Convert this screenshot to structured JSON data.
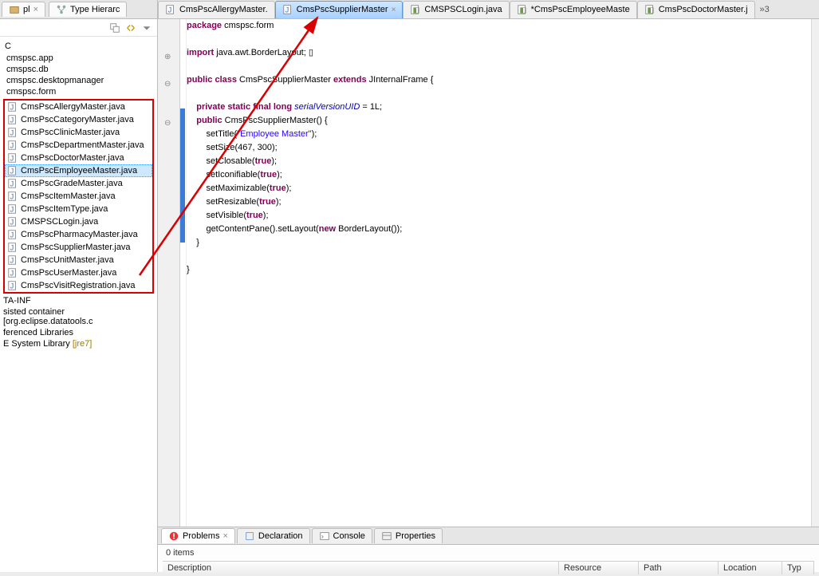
{
  "sidebar": {
    "tabs": [
      {
        "label": "pl"
      },
      {
        "label": "Type Hierarc"
      }
    ],
    "root": "C",
    "packages": [
      "cmspsc.app",
      "cmspsc.db",
      "cmspsc.desktopmanager",
      "cmspsc.form"
    ],
    "files": [
      "CmsPscAllergyMaster.java",
      "CmsPscCategoryMaster.java",
      "CmsPscClinicMaster.java",
      "CmsPscDepartmentMaster.java",
      "CmsPscDoctorMaster.java",
      "CmsPscEmployeeMaster.java",
      "CmsPscGradeMaster.java",
      "CmsPscItemMaster.java",
      "CmsPscItemType.java",
      "CMSPSCLogin.java",
      "CmsPscPharmacyMaster.java",
      "CmsPscSupplierMaster.java",
      "CmsPscUnitMaster.java",
      "CmsPscUserMaster.java",
      "CmsPscVisitRegistration.java"
    ],
    "selected_file_index": 5,
    "others": [
      "TA-INF",
      "sisted container [org.eclipse.datatools.c",
      "ferenced Libraries"
    ],
    "jre": {
      "prefix": "E System Library ",
      "suffix": "[jre7]"
    }
  },
  "editor": {
    "tabs": [
      {
        "label": "CmsPscAllergyMaster.",
        "type": "java"
      },
      {
        "label": "CmsPscSupplierMaster",
        "type": "java",
        "active": true
      },
      {
        "label": "CMSPSCLogin.java",
        "type": "form"
      },
      {
        "label": "*CmsPscEmployeeMaste",
        "type": "form"
      },
      {
        "label": "CmsPscDoctorMaster.j",
        "type": "form"
      }
    ],
    "more": "»3",
    "code": {
      "tokens": [
        {
          "t": "kw",
          "v": "package"
        },
        {
          "t": "p",
          "v": " cmspsc.form"
        },
        {
          "t": "nl"
        },
        {
          "t": "nl"
        },
        {
          "t": "kw",
          "v": "import"
        },
        {
          "t": "p",
          "v": " java.awt.BorderLayout; "
        },
        {
          "t": "sq",
          "v": "▯"
        },
        {
          "t": "nl"
        },
        {
          "t": "nl"
        },
        {
          "t": "kw",
          "v": "public"
        },
        {
          "t": "p",
          "v": " "
        },
        {
          "t": "kw",
          "v": "class"
        },
        {
          "t": "p",
          "v": " CmsPscSupplierMaster "
        },
        {
          "t": "kw",
          "v": "extends"
        },
        {
          "t": "p",
          "v": " JInternalFrame {"
        },
        {
          "t": "nl"
        },
        {
          "t": "nl"
        },
        {
          "t": "i",
          "v": "    "
        },
        {
          "t": "kw",
          "v": "private"
        },
        {
          "t": "p",
          "v": " "
        },
        {
          "t": "kw",
          "v": "static"
        },
        {
          "t": "p",
          "v": " "
        },
        {
          "t": "kw",
          "v": "final"
        },
        {
          "t": "p",
          "v": " "
        },
        {
          "t": "kw",
          "v": "long"
        },
        {
          "t": "p",
          "v": " "
        },
        {
          "t": "field",
          "v": "serialVersionUID"
        },
        {
          "t": "p",
          "v": " = 1L;"
        },
        {
          "t": "nl"
        },
        {
          "t": "i",
          "v": "    "
        },
        {
          "t": "kw",
          "v": "public"
        },
        {
          "t": "p",
          "v": " CmsPscSupplierMaster() {"
        },
        {
          "t": "nl"
        },
        {
          "t": "i",
          "v": "        "
        },
        {
          "t": "p",
          "v": "setTitle("
        },
        {
          "t": "str",
          "v": "\"Employee Master\""
        },
        {
          "t": "p",
          "v": ");"
        },
        {
          "t": "nl"
        },
        {
          "t": "i",
          "v": "        "
        },
        {
          "t": "p",
          "v": "setSize(467, 300);"
        },
        {
          "t": "nl"
        },
        {
          "t": "i",
          "v": "        "
        },
        {
          "t": "p",
          "v": "setClosable("
        },
        {
          "t": "kw",
          "v": "true"
        },
        {
          "t": "p",
          "v": ");"
        },
        {
          "t": "nl"
        },
        {
          "t": "i",
          "v": "        "
        },
        {
          "t": "p",
          "v": "setIconifiable("
        },
        {
          "t": "kw",
          "v": "true"
        },
        {
          "t": "p",
          "v": ");"
        },
        {
          "t": "nl"
        },
        {
          "t": "i",
          "v": "        "
        },
        {
          "t": "p",
          "v": "setMaximizable("
        },
        {
          "t": "kw",
          "v": "true"
        },
        {
          "t": "p",
          "v": ");"
        },
        {
          "t": "nl"
        },
        {
          "t": "i",
          "v": "        "
        },
        {
          "t": "p",
          "v": "setResizable("
        },
        {
          "t": "kw",
          "v": "true"
        },
        {
          "t": "p",
          "v": ");"
        },
        {
          "t": "nl"
        },
        {
          "t": "i",
          "v": "        "
        },
        {
          "t": "p",
          "v": "setVisible("
        },
        {
          "t": "kw",
          "v": "true"
        },
        {
          "t": "p",
          "v": ");"
        },
        {
          "t": "nl"
        },
        {
          "t": "i",
          "v": "        "
        },
        {
          "t": "p",
          "v": "getContentPane().setLayout("
        },
        {
          "t": "kw",
          "v": "new"
        },
        {
          "t": "p",
          "v": " BorderLayout());"
        },
        {
          "t": "nl"
        },
        {
          "t": "i",
          "v": "    "
        },
        {
          "t": "p",
          "v": "}"
        },
        {
          "t": "nl"
        },
        {
          "t": "nl"
        },
        {
          "t": "p",
          "v": "}"
        },
        {
          "t": "nl"
        }
      ]
    }
  },
  "bottom": {
    "tabs": [
      "Problems",
      "Declaration",
      "Console",
      "Properties"
    ],
    "count": "0 items",
    "cols": [
      "Description",
      "Resource",
      "Path",
      "Location",
      "Typ"
    ]
  },
  "annotation": {
    "note": "red arrow from file list to active editor tab"
  }
}
